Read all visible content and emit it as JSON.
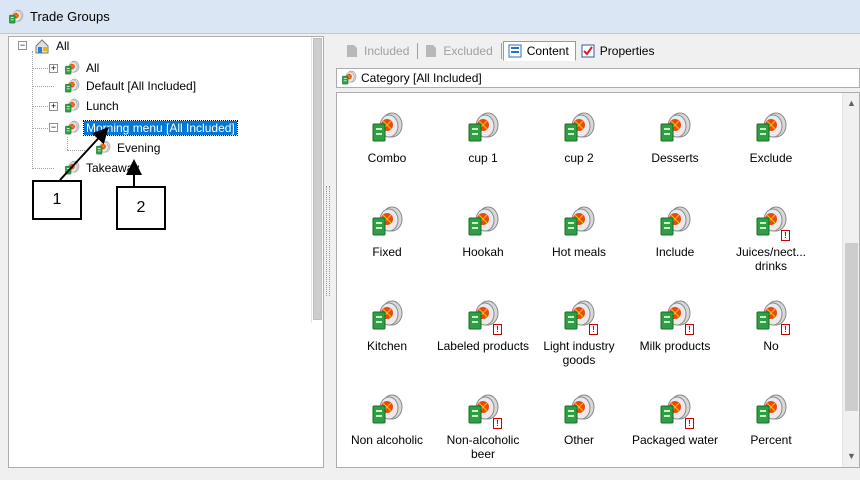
{
  "window": {
    "title": "Trade Groups"
  },
  "tree": {
    "root": {
      "label": "All"
    },
    "nodes": [
      {
        "label": "All"
      },
      {
        "label": "Default [All Included]"
      },
      {
        "label": "Lunch"
      },
      {
        "label": "Morning menu [All Included]"
      },
      {
        "label": "Evening"
      },
      {
        "label": "Takeaway"
      }
    ]
  },
  "tabs": [
    {
      "label": "Included",
      "state": "disabled"
    },
    {
      "label": "Excluded",
      "state": "disabled"
    },
    {
      "label": "Content",
      "state": "active"
    },
    {
      "label": "Properties",
      "state": "normal"
    }
  ],
  "category": {
    "label": "Category [All Included]"
  },
  "items": [
    {
      "label": "Combo",
      "badge": false
    },
    {
      "label": "cup 1",
      "badge": false
    },
    {
      "label": "cup 2",
      "badge": false
    },
    {
      "label": "Desserts",
      "badge": false
    },
    {
      "label": "Exclude",
      "badge": false
    },
    {
      "label": "Fixed",
      "badge": false
    },
    {
      "label": "Hookah",
      "badge": false
    },
    {
      "label": "Hot meals",
      "badge": false
    },
    {
      "label": "Include",
      "badge": false
    },
    {
      "label": "Juices/nect... drinks",
      "badge": true
    },
    {
      "label": "Kitchen",
      "badge": false
    },
    {
      "label": "Labeled products",
      "badge": true
    },
    {
      "label": "Light industry goods",
      "badge": true
    },
    {
      "label": "Milk products",
      "badge": true
    },
    {
      "label": "No",
      "badge": true
    },
    {
      "label": "Non alcoholic",
      "badge": false
    },
    {
      "label": "Non-alcoholic beer",
      "badge": true
    },
    {
      "label": "Other",
      "badge": false
    },
    {
      "label": "Packaged water",
      "badge": true
    },
    {
      "label": "Percent",
      "badge": false
    }
  ],
  "annotations": [
    {
      "label": "1"
    },
    {
      "label": "2"
    }
  ],
  "icons": {
    "group": "trade-group-icon",
    "root": "house-group-icon",
    "badge": "!"
  },
  "colors": {
    "selection": "#0078d7",
    "titlebar": "#dbe6f4"
  }
}
